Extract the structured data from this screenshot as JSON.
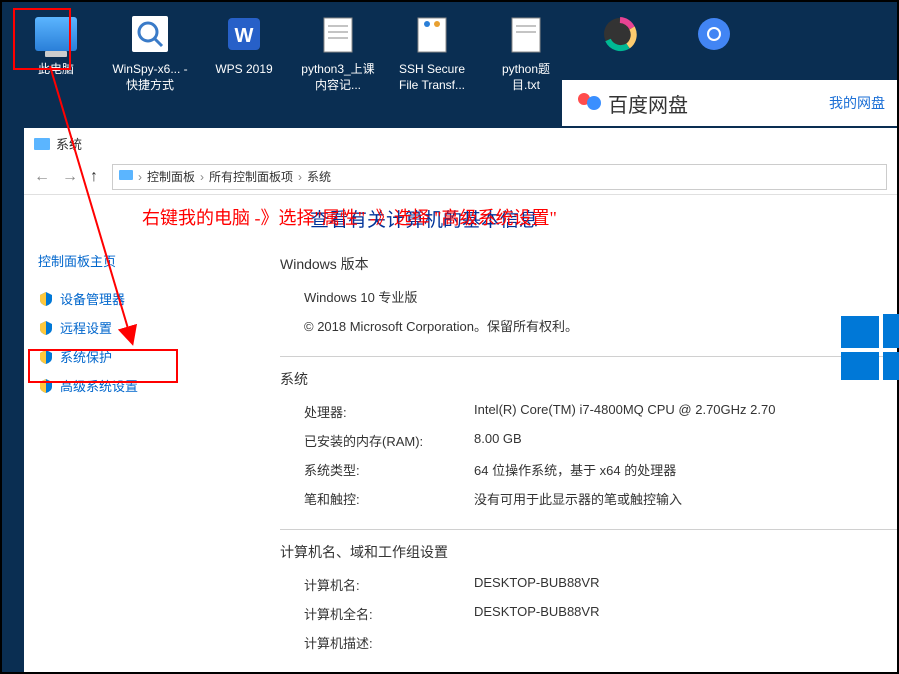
{
  "desktop": {
    "icons": [
      {
        "label": "此电脑"
      },
      {
        "label": "WinSpy-x6... - 快捷方式"
      },
      {
        "label": "WPS 2019"
      },
      {
        "label": "python3_上课内容记..."
      },
      {
        "label": "SSH Secure File Transf..."
      },
      {
        "label": "python题目.txt"
      }
    ]
  },
  "baidu": {
    "title": "百度网盘",
    "link": "我的网盘"
  },
  "window": {
    "title": "系统",
    "breadcrumbs": [
      "控制面板",
      "所有控制面板项",
      "系统"
    ]
  },
  "sidebar": {
    "title": "控制面板主页",
    "items": [
      "设备管理器",
      "远程设置",
      "系统保护",
      "高级系统设置"
    ]
  },
  "annotation": {
    "text": "右键我的电脑 -》选择\"属性\"  -》选择 \"高级系统设置\""
  },
  "content": {
    "heading": "查看有关计算机的基本信息",
    "windows_section": "Windows 版本",
    "windows_edition": "Windows 10 专业版",
    "copyright": "© 2018 Microsoft Corporation。保留所有权利。",
    "system_section": "系统",
    "rows": [
      {
        "label": "处理器:",
        "value": "Intel(R) Core(TM) i7-4800MQ CPU @ 2.70GHz   2.70"
      },
      {
        "label": "已安装的内存(RAM):",
        "value": "8.00 GB"
      },
      {
        "label": "系统类型:",
        "value": "64 位操作系统，基于 x64 的处理器"
      },
      {
        "label": "笔和触控:",
        "value": "没有可用于此显示器的笔或触控输入"
      }
    ],
    "computer_section": "计算机名、域和工作组设置",
    "computer_rows": [
      {
        "label": "计算机名:",
        "value": "DESKTOP-BUB88VR"
      },
      {
        "label": "计算机全名:",
        "value": "DESKTOP-BUB88VR"
      },
      {
        "label": "计算机描述:",
        "value": ""
      }
    ]
  }
}
